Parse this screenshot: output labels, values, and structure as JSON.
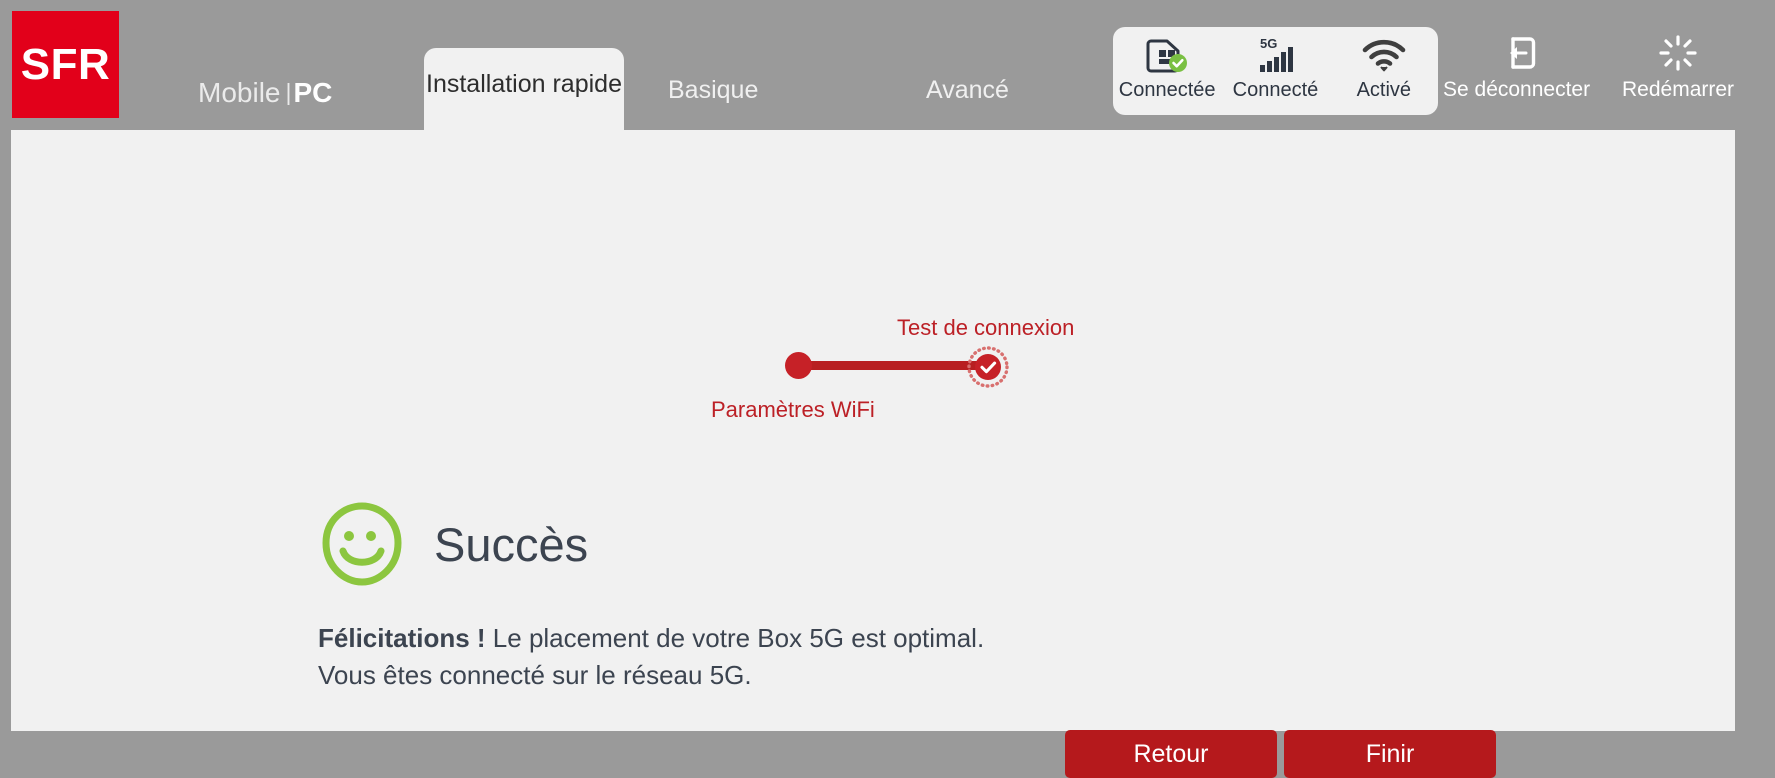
{
  "brand": {
    "logo_text": "SFR",
    "logo_color": "#e2001a",
    "nav_mobile": "Mobile",
    "nav_separator": "|",
    "nav_pc": "PC"
  },
  "header": {
    "tabs": [
      {
        "label": "Installation rapide",
        "active": true
      },
      {
        "label": "Basique",
        "active": false
      },
      {
        "label": "Avancé",
        "active": false
      }
    ],
    "status": [
      {
        "icon": "sim-card-icon",
        "label": "Connectée"
      },
      {
        "icon": "signal-bars-5g-icon",
        "label": "Connecté",
        "badge": "5G"
      },
      {
        "icon": "wifi-icon",
        "label": "Activé"
      }
    ],
    "actions": [
      {
        "icon": "logout-icon",
        "label": "Se déconnecter"
      },
      {
        "icon": "restart-icon",
        "label": "Redémarrer"
      }
    ]
  },
  "stepper": {
    "steps": [
      {
        "label": "Paramètres WiFi",
        "state": "done",
        "position": "below"
      },
      {
        "label": "Test de connexion",
        "state": "current",
        "position": "above"
      }
    ],
    "accent_color": "#bc2026"
  },
  "main": {
    "status_icon": "smiley-face-icon",
    "status_icon_color": "#8cc63f",
    "title": "Succès",
    "body_strong": "Félicitations !",
    "body_line1_rest": " Le placement de votre Box 5G est optimal.",
    "body_line2": "Vous êtes connecté sur le réseau 5G."
  },
  "buttons": {
    "back": "Retour",
    "finish": "Finir",
    "color": "#b5191c"
  }
}
